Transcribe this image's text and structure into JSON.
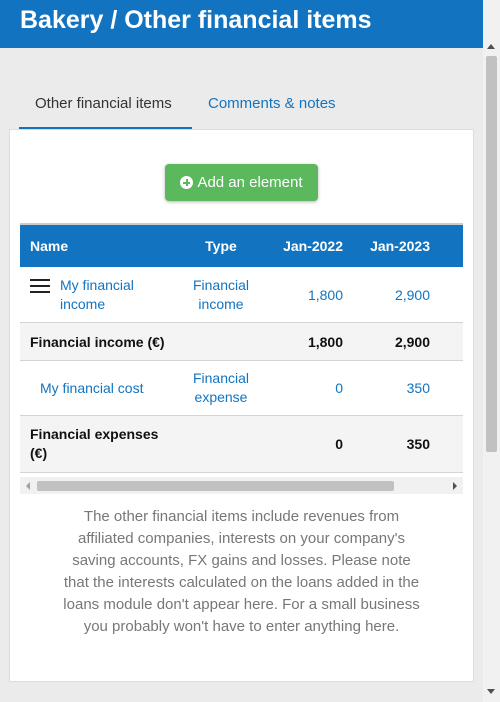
{
  "header": {
    "title": "Bakery  /  Other financial items"
  },
  "tabs": [
    {
      "label": "Other financial items"
    },
    {
      "label": "Comments & notes"
    }
  ],
  "add_button": {
    "label": "Add an element"
  },
  "table": {
    "columns": [
      "Name",
      "Type",
      "Jan-2022",
      "Jan-2023"
    ],
    "rows": [
      {
        "name": "My financial income",
        "type": "Financial income",
        "jan2022": "1,800",
        "jan2023": "2,900"
      },
      {
        "name": "Financial income (€)",
        "type": "",
        "jan2022": "1,800",
        "jan2023": "2,900"
      },
      {
        "name": "My financial cost",
        "type": "Financial expense",
        "jan2022": "0",
        "jan2023": "350"
      },
      {
        "name": "Financial expenses (€)",
        "type": "",
        "jan2022": "0",
        "jan2023": "350"
      }
    ]
  },
  "info_text": "The other financial items include revenues from affiliated companies, interests on your company's saving accounts, FX gains and losses. Please note that the interests calculated on the loans added in the loans module don't appear here. For a small business you probably won't have to enter anything here.",
  "colors": {
    "primary": "#1274c0",
    "success": "#5cb85c"
  },
  "icons": [
    "plus-circle-icon",
    "menu-icon"
  ]
}
